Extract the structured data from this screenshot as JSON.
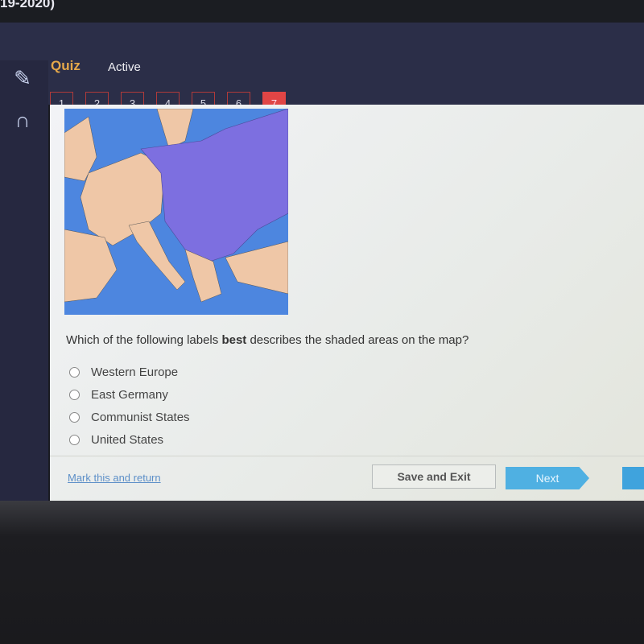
{
  "breadcrumb": "19-2020)",
  "tabs": {
    "quiz": "Quiz",
    "status": "Active"
  },
  "questions": [
    "1",
    "2",
    "3",
    "4",
    "5",
    "6",
    "7"
  ],
  "current_question": "7",
  "question": {
    "before": "Which of the following labels ",
    "bold": "best",
    "after": " describes the shaded areas on the map?"
  },
  "options": [
    "Western Europe",
    "East Germany",
    "Communist States",
    "United States"
  ],
  "footer": {
    "mark": "Mark this and return",
    "save": "Save and Exit",
    "next": "Next"
  },
  "colors": {
    "accent": "#e6a94a",
    "current": "#e04545",
    "next": "#4fb0e2",
    "shaded": "#7d6fe0",
    "unshaded": "#efc7a7",
    "water": "#4d86df"
  }
}
